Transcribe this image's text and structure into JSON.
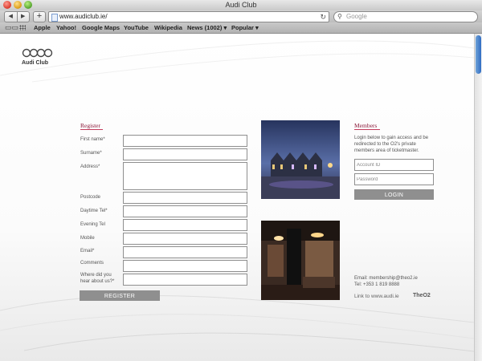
{
  "window": {
    "title": "Audi Club"
  },
  "toolbar": {
    "back_icon": "back-arrow-icon",
    "forward_icon": "forward-arrow-icon",
    "add_label": "+",
    "url": "www.audiclub.ie/",
    "search_placeholder": "Google"
  },
  "bookmarks": [
    "Apple",
    "Yahoo!",
    "Google Maps",
    "YouTube",
    "Wikipedia",
    "News (1002) ▾",
    "Popular ▾"
  ],
  "site": {
    "logo_text": "Audi Club"
  },
  "register": {
    "title": "Register",
    "fields": {
      "first_name": "First name*",
      "surname": "Surname*",
      "address": "Address*",
      "postcode": "Postcode",
      "daytime_tel": "Daytime Tel*",
      "evening_tel": "Evening Tel",
      "mobile": "Mobile",
      "email": "Email*",
      "comments": "Comments",
      "hear_about_1": "Where did you",
      "hear_about_2": "hear about us?*"
    },
    "button": "REGISTER"
  },
  "members": {
    "title": "Members",
    "intro": "Login below to gain access and be redirected to the O2's private members area of ticketmaster.",
    "account_placeholder": "Account ID",
    "password_placeholder": "Password",
    "button": "LOGIN",
    "email_line": "Email: membership@theo2.ie",
    "tel_line": "Tel: +353 1 819 8888",
    "link_text": "Link to www.audi.ie",
    "o2_logo": "TheO2"
  },
  "colors": {
    "accent": "#c33c5c",
    "button": "#8f8f8f",
    "scroll": "#2f6cc2"
  }
}
